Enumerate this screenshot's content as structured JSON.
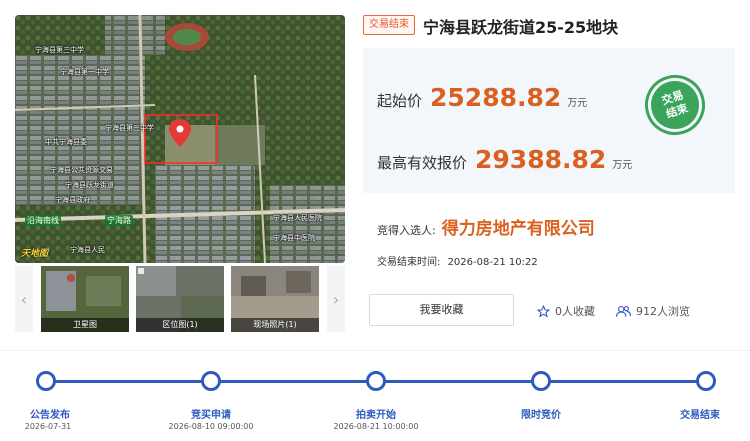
{
  "map": {
    "labels": [
      "宁海县第三中学",
      "宁海县第一中学",
      "宁海县第三中学",
      "中共宁海县委",
      "宁海县公共资源交易",
      "宁海县跃龙街道",
      "宁海县政府",
      "宁海县人民",
      "沿海南线",
      "宁海路",
      "宁海县人民医院",
      "宁海县中医院"
    ],
    "watermark": "天地图",
    "marker_icon": "location-pin-icon"
  },
  "thumbnails": [
    {
      "caption": "卫星图"
    },
    {
      "caption": "区位图(1)"
    },
    {
      "caption": "现场照片(1)"
    }
  ],
  "badge": "交易结束",
  "title": "宁海县跃龙街道25-25地块",
  "start_price": {
    "label": "起始价",
    "value": "25288.82",
    "unit": "万元"
  },
  "max_bid": {
    "label": "最高有效报价",
    "value": "29388.82",
    "unit": "万元"
  },
  "stamp": {
    "line1": "交易",
    "line2": "结束"
  },
  "winner": {
    "label": "竞得入选人:",
    "value": "得力房地产有限公司"
  },
  "end_time": {
    "label": "交易结束时间:",
    "value": "2026-08-21 10:22"
  },
  "favorite_button": "我要收藏",
  "favorites": "0人收藏",
  "views": "912人浏览",
  "timeline": [
    {
      "label": "公告发布",
      "date": "2026-07-31"
    },
    {
      "label": "竞买申请",
      "date": "2026-08-10 09:00:00"
    },
    {
      "label": "拍卖开始",
      "date": "2026-08-21 10:00:00"
    },
    {
      "label": "限时竞价",
      "date": ""
    },
    {
      "label": "交易结束",
      "date": ""
    }
  ],
  "colors": {
    "accent": "#d9601f",
    "timeline": "#2d5bbf",
    "stamp": "#3aa45a"
  }
}
